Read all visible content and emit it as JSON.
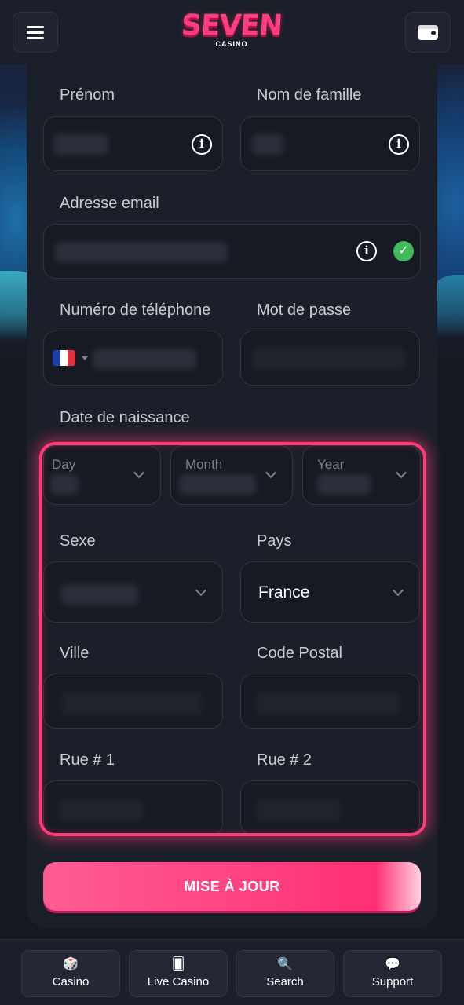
{
  "header": {
    "logo_text": "SEVEN",
    "logo_subtext": "CASINO",
    "menu_icon": "hamburger-menu-icon",
    "wallet_icon": "wallet-icon"
  },
  "form": {
    "first_name_label": "Prénom",
    "last_name_label": "Nom de famille",
    "email_label": "Adresse email",
    "phone_label": "Numéro de téléphone",
    "password_label": "Mot de passe",
    "birthdate_label": "Date de naissance",
    "day_placeholder": "Day",
    "month_placeholder": "Month",
    "year_placeholder": "Year",
    "gender_label": "Sexe",
    "country_label": "Pays",
    "country_value": "France",
    "city_label": "Ville",
    "postal_label": "Code Postal",
    "street1_label": "Rue # 1",
    "street2_label": "Rue # 2",
    "info_glyph": "i",
    "check_glyph": "✓",
    "submit_label": "MISE À JOUR"
  },
  "bottom_nav": {
    "items": [
      {
        "label": "Casino",
        "icon": "dice-icon",
        "glyph": "🎲"
      },
      {
        "label": "Live Casino",
        "icon": "cards-icon",
        "glyph": "🂠"
      },
      {
        "label": "Search",
        "icon": "search-icon",
        "glyph": "🔍"
      },
      {
        "label": "Support",
        "icon": "chat-icon",
        "glyph": "💬"
      }
    ]
  },
  "colors": {
    "accent": "#ff3a78",
    "background": "#161922",
    "card": "#1b1f29",
    "success": "#41b85c"
  }
}
